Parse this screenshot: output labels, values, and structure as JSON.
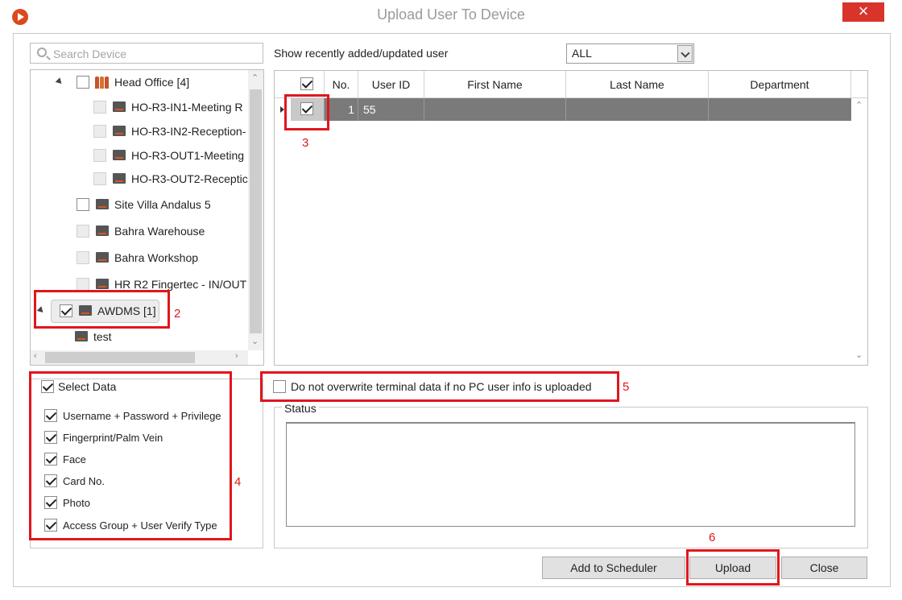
{
  "window": {
    "title": "Upload User To Device",
    "close_label": "×"
  },
  "search": {
    "placeholder": "Search Device"
  },
  "tree": [
    {
      "label": "Head Office [4]",
      "type": "group",
      "checked": false
    },
    {
      "label": "HO-R3-IN1-Meeting R",
      "type": "device",
      "disabled": true
    },
    {
      "label": "HO-R3-IN2-Reception-",
      "type": "device",
      "disabled": true
    },
    {
      "label": "HO-R3-OUT1-Meeting",
      "type": "device",
      "disabled": true
    },
    {
      "label": "HO-R3-OUT2-Receptic",
      "type": "device",
      "disabled": true
    },
    {
      "label": "Site Villa Andalus 5",
      "type": "device",
      "disabled": false
    },
    {
      "label": "Bahra Warehouse",
      "type": "device",
      "disabled": true
    },
    {
      "label": "Bahra Workshop",
      "type": "device",
      "disabled": true
    },
    {
      "label": "HR R2 Fingertec - IN/OUT",
      "type": "device",
      "disabled": true
    },
    {
      "label": "AWDMS [1]",
      "type": "device",
      "checked": true
    },
    {
      "label": "test",
      "type": "device"
    }
  ],
  "recent": {
    "label": "Show recently added/updated user",
    "value": "ALL"
  },
  "grid": {
    "columns": [
      "No.",
      "User ID",
      "First Name",
      "Last Name",
      "Department"
    ],
    "rows": [
      {
        "checked": true,
        "no": "1",
        "user_id": "55",
        "first_name": "",
        "last_name": "",
        "department": ""
      }
    ]
  },
  "select_data": {
    "title": "Select Data",
    "items": [
      "Username + Password + Privilege",
      "Fingerprint/Palm Vein",
      "Face",
      "Card No.",
      "Photo",
      "Access Group + User Verify Type"
    ]
  },
  "overwrite": {
    "label": "Do not overwrite terminal data if no PC user info is uploaded",
    "checked": false
  },
  "status": {
    "legend": "Status",
    "text": ""
  },
  "buttons": {
    "scheduler": "Add to Scheduler",
    "upload": "Upload",
    "close": "Close"
  },
  "annotations": [
    "2",
    "3",
    "4",
    "5",
    "6"
  ],
  "colors": {
    "annotation": "#e0161c",
    "selected_row": "#7a7a7a",
    "app_icon": "#d94a1c"
  }
}
